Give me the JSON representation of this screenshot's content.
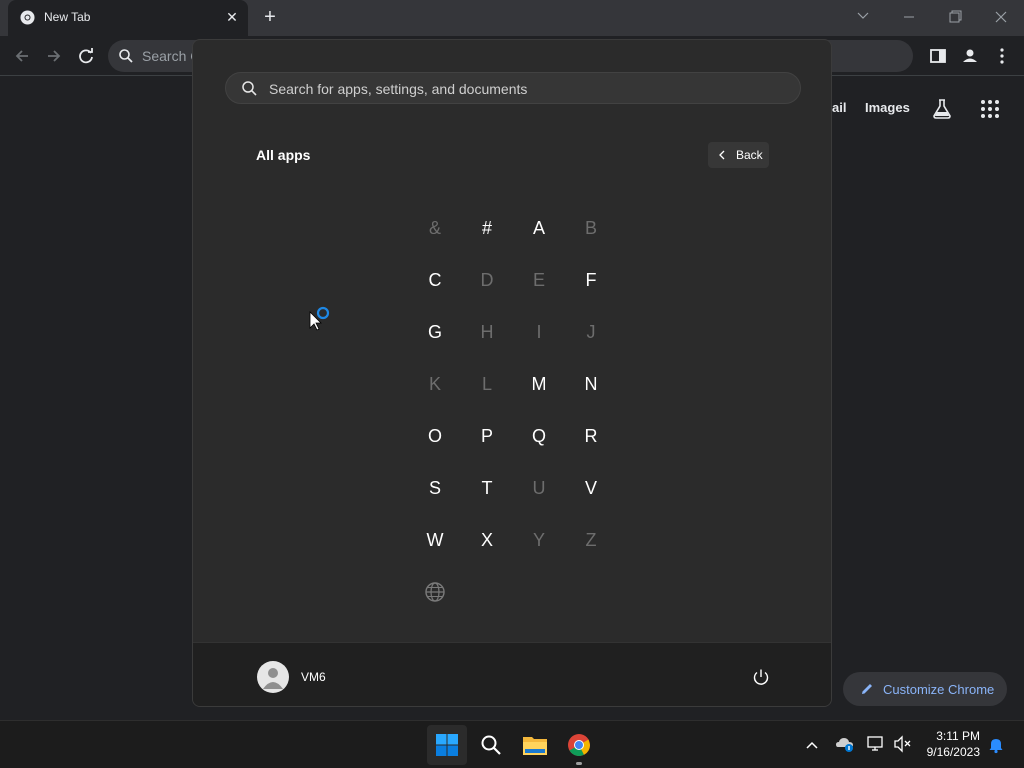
{
  "browser": {
    "tab_title": "New Tab",
    "omnibox_placeholder": "Search G",
    "ntp_links": {
      "gmail": "ail",
      "images": "Images"
    },
    "customize_label": "Customize Chrome"
  },
  "start_menu": {
    "search_placeholder": "Search for apps, settings, and documents",
    "heading": "All apps",
    "back_label": "Back",
    "letters": [
      {
        "char": "&",
        "enabled": false
      },
      {
        "char": "#",
        "enabled": true
      },
      {
        "char": "A",
        "enabled": true
      },
      {
        "char": "B",
        "enabled": false
      },
      {
        "char": "C",
        "enabled": true
      },
      {
        "char": "D",
        "enabled": false
      },
      {
        "char": "E",
        "enabled": false
      },
      {
        "char": "F",
        "enabled": true
      },
      {
        "char": "G",
        "enabled": true
      },
      {
        "char": "H",
        "enabled": false
      },
      {
        "char": "I",
        "enabled": false
      },
      {
        "char": "J",
        "enabled": false
      },
      {
        "char": "K",
        "enabled": false
      },
      {
        "char": "L",
        "enabled": false
      },
      {
        "char": "M",
        "enabled": true
      },
      {
        "char": "N",
        "enabled": true
      },
      {
        "char": "O",
        "enabled": true
      },
      {
        "char": "P",
        "enabled": true
      },
      {
        "char": "Q",
        "enabled": true
      },
      {
        "char": "R",
        "enabled": true
      },
      {
        "char": "S",
        "enabled": true
      },
      {
        "char": "T",
        "enabled": true
      },
      {
        "char": "U",
        "enabled": false
      },
      {
        "char": "V",
        "enabled": true
      },
      {
        "char": "W",
        "enabled": true
      },
      {
        "char": "X",
        "enabled": true
      },
      {
        "char": "Y",
        "enabled": false
      },
      {
        "char": "Z",
        "enabled": false
      }
    ],
    "user_name": "VM6"
  },
  "taskbar": {
    "time": "3:11 PM",
    "date": "9/16/2023"
  },
  "colors": {
    "accent_blue": "#8ab4f8",
    "windows_blue": "#0078d4"
  }
}
